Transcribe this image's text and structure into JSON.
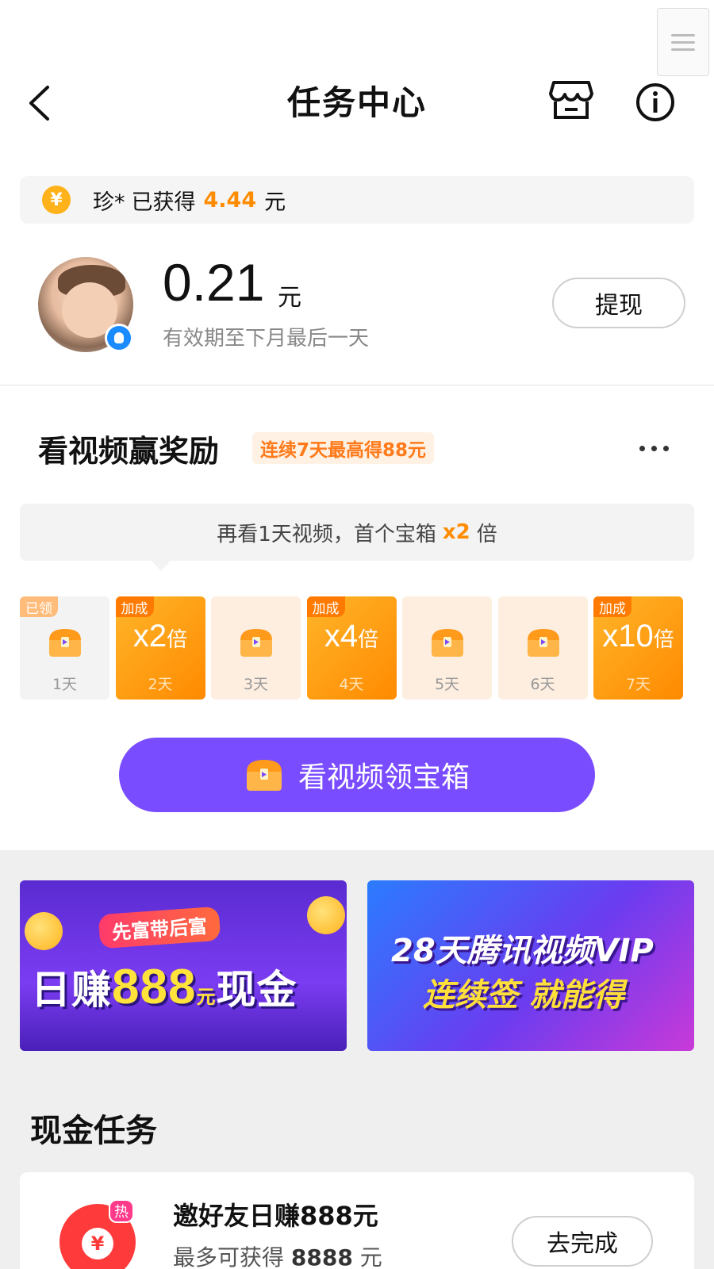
{
  "header": {
    "title": "任务中心",
    "back_icon": "chevron-left-icon",
    "shop_icon": "store-icon",
    "info_icon": "info-circle-icon"
  },
  "notice": {
    "user": "珍*",
    "text": "已获得",
    "amount": "4.44",
    "unit": "元"
  },
  "balance": {
    "amount": "0.21",
    "unit": "元",
    "validity": "有效期至下月最后一天",
    "withdraw_label": "提现"
  },
  "video_reward": {
    "title": "看视频赢奖励",
    "tag": "连续7天最高得88元",
    "tip_prefix": "再看1天视频，首个宝箱",
    "tip_multiplier": "x2",
    "tip_suffix": "倍",
    "days": [
      {
        "label": "1天",
        "tag": "已领",
        "type": "claimed"
      },
      {
        "label": "2天",
        "tag": "加成",
        "type": "bonus",
        "mult": "x2",
        "mult_unit": "倍"
      },
      {
        "label": "3天",
        "type": "plain"
      },
      {
        "label": "4天",
        "tag": "加成",
        "type": "bonus",
        "mult": "x4",
        "mult_unit": "倍"
      },
      {
        "label": "5天",
        "type": "plain"
      },
      {
        "label": "6天",
        "type": "plain"
      },
      {
        "label": "7天",
        "tag": "加成",
        "type": "bonus",
        "mult": "x10",
        "mult_unit": "倍"
      }
    ],
    "watch_button": "看视频领宝箱"
  },
  "banners": {
    "left": {
      "sub": "先富带后富",
      "main_a": "日赚",
      "main_num": "888",
      "main_unit": "元",
      "main_b": "现金"
    },
    "right": {
      "line1": "28天腾讯视频VIP",
      "line2": "连续签 就能得"
    }
  },
  "cash_tasks": {
    "title": "现金任务",
    "items": [
      {
        "name": "邀好友日赚888元",
        "desc_prefix": "最多可获得",
        "desc_amount": "8888",
        "desc_unit": "元",
        "icon_badge": "热",
        "icon_symbol": "¥",
        "button": "去完成"
      }
    ]
  },
  "colors": {
    "accent_orange": "#ff8c00",
    "purple_button": "#7a4cff"
  }
}
